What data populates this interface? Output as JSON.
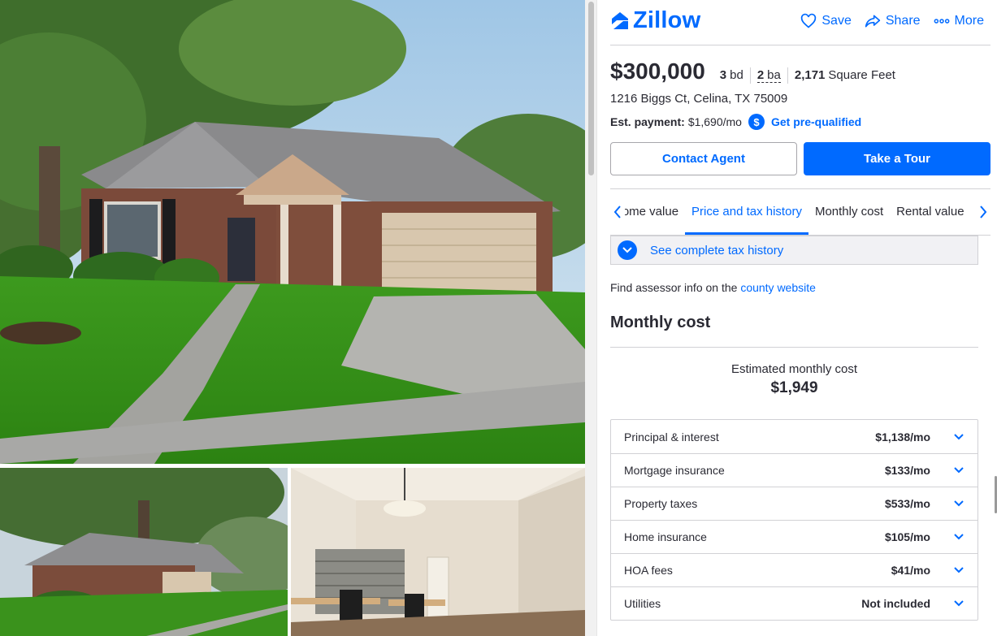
{
  "header": {
    "logo_text": "Zillow",
    "save_label": "Save",
    "share_label": "Share",
    "more_label": "More"
  },
  "listing": {
    "price": "$300,000",
    "beds_value": "3",
    "beds_unit": "bd",
    "baths_value": "2",
    "baths_unit": "ba",
    "sqft_value": "2,171",
    "sqft_unit": "Square Feet",
    "address": "1216 Biggs Ct, Celina, TX 75009",
    "est_payment_label": "Est. payment:",
    "est_payment_value": "$1,690/mo",
    "prequal_badge": "$",
    "prequal_label": "Get pre-qualified"
  },
  "cta": {
    "contact_label": "Contact Agent",
    "tour_label": "Take a Tour"
  },
  "tabs": [
    {
      "label": "Home value",
      "active": false
    },
    {
      "label": "Price and tax history",
      "active": true
    },
    {
      "label": "Monthly cost",
      "active": false
    },
    {
      "label": "Rental value",
      "active": false
    }
  ],
  "tax": {
    "see_history_label": "See complete tax history",
    "assessor_text": "Find assessor info on the",
    "assessor_link": "county website"
  },
  "monthly": {
    "section_title": "Monthly cost",
    "summary_label": "Estimated monthly cost",
    "summary_value": "$1,949",
    "rows": [
      {
        "name": "Principal & interest",
        "amount": "$1,138/mo"
      },
      {
        "name": "Mortgage insurance",
        "amount": "$133/mo"
      },
      {
        "name": "Property taxes",
        "amount": "$533/mo"
      },
      {
        "name": "Home insurance",
        "amount": "$105/mo"
      },
      {
        "name": "HOA fees",
        "amount": "$41/mo"
      },
      {
        "name": "Utilities",
        "amount": "Not included"
      }
    ]
  },
  "colors": {
    "brand": "#006aff",
    "text": "#2a2a33",
    "border": "#d1d1d5"
  },
  "icons": {
    "save": "heart-icon",
    "share": "share-arrow-icon",
    "more": "three-dots-icon",
    "expand": "chevron-down-icon"
  }
}
